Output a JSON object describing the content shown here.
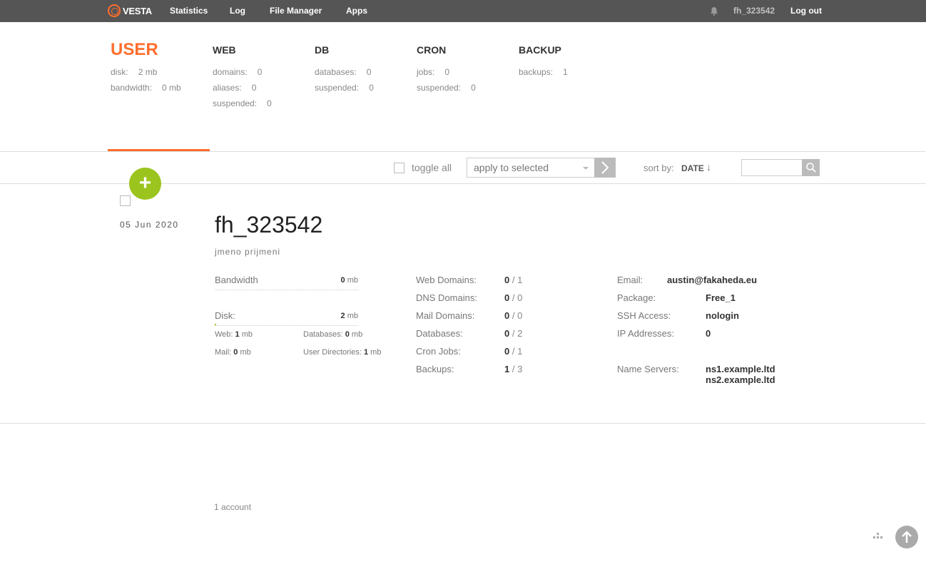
{
  "nav": {
    "logo": "VESTA",
    "links": [
      "Statistics",
      "Log",
      "File Manager",
      "Apps"
    ],
    "user": "fh_323542",
    "logout": "Log out",
    "bell_icon": "bell-icon"
  },
  "summary": {
    "user": {
      "title": "USER",
      "stats": [
        {
          "label": "disk:",
          "value": "2 mb"
        },
        {
          "label": "bandwidth:",
          "value": "0 mb"
        }
      ]
    },
    "web": {
      "title": "WEB",
      "stats": [
        {
          "label": "domains:",
          "value": "0"
        },
        {
          "label": "aliases:",
          "value": "0"
        },
        {
          "label": "suspended:",
          "value": "0"
        }
      ]
    },
    "db": {
      "title": "DB",
      "stats": [
        {
          "label": "databases:",
          "value": "0"
        },
        {
          "label": "suspended:",
          "value": "0"
        }
      ]
    },
    "cron": {
      "title": "CRON",
      "stats": [
        {
          "label": "jobs:",
          "value": "0"
        },
        {
          "label": "suspended:",
          "value": "0"
        }
      ]
    },
    "backup": {
      "title": "BACKUP",
      "stats": [
        {
          "label": "backups:",
          "value": "1"
        }
      ]
    }
  },
  "toolbar": {
    "toggle_all": "toggle all",
    "apply_selected": "apply to selected",
    "sort_by": "sort by:",
    "sort_value": "DATE",
    "sort_arrow": "↓",
    "search_placeholder": ""
  },
  "add_button": "+",
  "account": {
    "date": "05  Jun  2020",
    "name": "fh_323542",
    "full_name": "jmeno prijmeni",
    "bandwidth": {
      "label": "Bandwidth",
      "value": "0",
      "unit": "mb"
    },
    "disk": {
      "label": "Disk:",
      "value": "2",
      "unit": "mb",
      "usage_fraction": 0.01
    },
    "disk_breakdown": {
      "web": {
        "label": "Web:",
        "value": "1",
        "unit": "mb"
      },
      "databases": {
        "label": "Databases:",
        "value": "0",
        "unit": "mb"
      },
      "mail": {
        "label": "Mail:",
        "value": "0",
        "unit": "mb"
      },
      "user_dirs": {
        "label": "User Directories:",
        "value": "1",
        "unit": "mb"
      }
    },
    "counts": [
      {
        "label": "Web Domains:",
        "used": "0",
        "limit": "/ 1"
      },
      {
        "label": "DNS Domains:",
        "used": "0",
        "limit": "/ 0"
      },
      {
        "label": "Mail Domains:",
        "used": "0",
        "limit": "/ 0"
      },
      {
        "label": "Databases:",
        "used": "0",
        "limit": "/ 2"
      },
      {
        "label": "Cron Jobs:",
        "used": "0",
        "limit": "/ 1"
      },
      {
        "label": "Backups:",
        "used": "1",
        "limit": "/ 3"
      }
    ],
    "info": {
      "email_label": "Email:",
      "email": "austin@fakaheda.eu",
      "package_label": "Package:",
      "package": "Free_1",
      "ssh_label": "SSH Access:",
      "ssh": "nologin",
      "ip_label": "IP Addresses:",
      "ip": "0",
      "ns_label": "Name Servers:",
      "ns1": "ns1.example.ltd",
      "ns2": "ns2.example.ltd"
    }
  },
  "footer": {
    "count": "1 account"
  },
  "colors": {
    "accent": "#ff6e2d",
    "green": "#9bc41e",
    "nav_bg": "#555555"
  }
}
